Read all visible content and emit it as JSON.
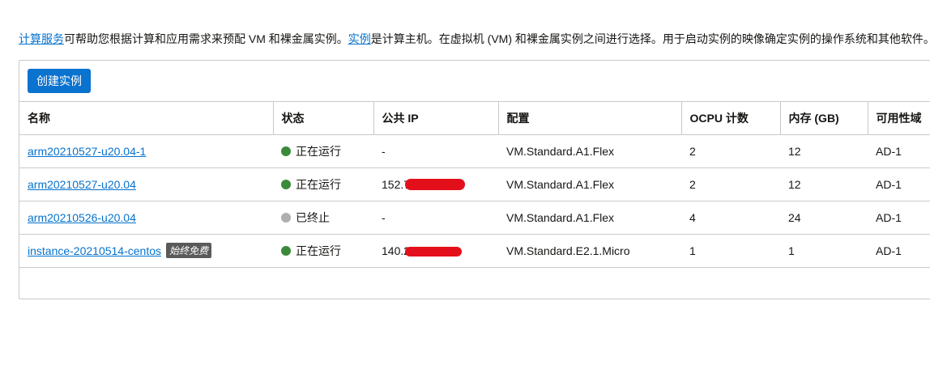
{
  "intro": {
    "link1": "计算服务",
    "text1": "可帮助您根据计算和应用需求来预配 VM 和裸金属实例。",
    "link2": "实例",
    "text2": "是计算主机。在虚拟机 (VM) 和裸金属实例之间进行选择。用于启动实例的映像确定实例的操作系统和其他软件。"
  },
  "toolbar": {
    "create_label": "创建实例"
  },
  "table": {
    "headers": [
      "名称",
      "状态",
      "公共 IP",
      "配置",
      "OCPU 计数",
      "内存 (GB)",
      "可用性域"
    ],
    "rows": [
      {
        "name": "arm20210527-u20.04-1",
        "badge": "",
        "status": "正在运行",
        "status_color": "#3a8a3a",
        "ip": "-",
        "ip_redacted": false,
        "shape": "VM.Standard.A1.Flex",
        "ocpu": "2",
        "memory": "12",
        "ad": "AD-1"
      },
      {
        "name": "arm20210527-u20.04",
        "badge": "",
        "status": "正在运行",
        "status_color": "#3a8a3a",
        "ip": "152.7",
        "ip_redacted": true,
        "shape": "VM.Standard.A1.Flex",
        "ocpu": "2",
        "memory": "12",
        "ad": "AD-1"
      },
      {
        "name": "arm20210526-u20.04",
        "badge": "",
        "status": "已终止",
        "status_color": "#aeaeae",
        "ip": "-",
        "ip_redacted": false,
        "shape": "VM.Standard.A1.Flex",
        "ocpu": "4",
        "memory": "24",
        "ad": "AD-1"
      },
      {
        "name": "instance-20210514-centos",
        "badge": "始终免费",
        "status": "正在运行",
        "status_color": "#3a8a3a",
        "ip": "140.2",
        "ip_redacted": true,
        "shape": "VM.Standard.E2.1.Micro",
        "ocpu": "1",
        "memory": "1",
        "ad": "AD-1"
      }
    ]
  },
  "colors": {
    "accent": "#0a72cf",
    "link": "#0572ce",
    "running": "#3a8a3a",
    "terminated": "#aeaeae",
    "redaction": "#e3101b"
  }
}
